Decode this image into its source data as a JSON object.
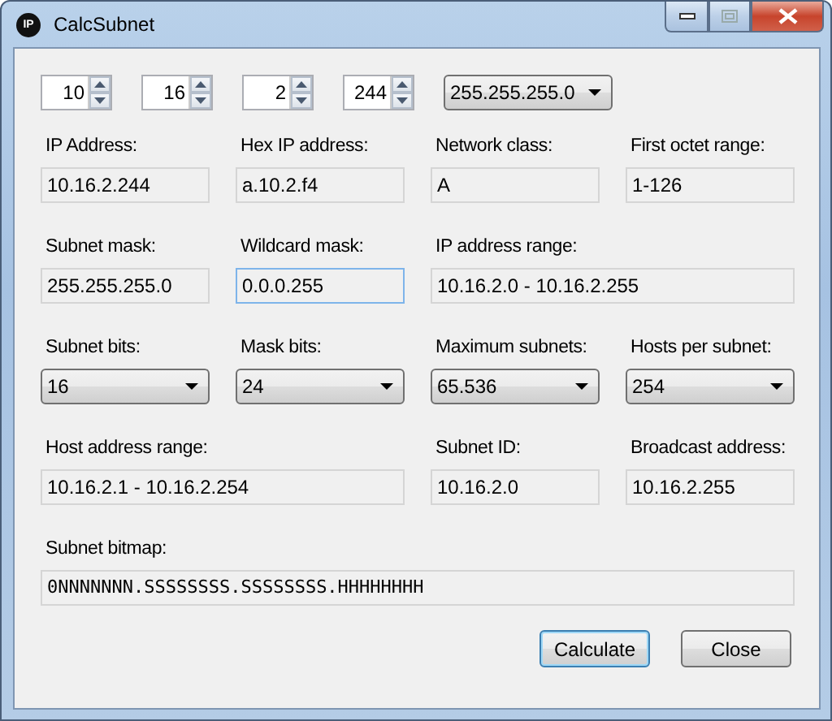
{
  "window": {
    "title": "CalcSubnet",
    "icon_text": "IP"
  },
  "octets": [
    {
      "value": "10"
    },
    {
      "value": "16"
    },
    {
      "value": "2"
    },
    {
      "value": "244"
    }
  ],
  "mask_select": {
    "value": "255.255.255.0"
  },
  "rows": [
    [
      {
        "kind": "text",
        "label": "IP Address:",
        "value": "10.16.2.244",
        "focused": false
      },
      {
        "kind": "text",
        "label": "Hex IP address:",
        "value": "a.10.2.f4",
        "focused": false
      },
      {
        "kind": "text",
        "label": "Network class:",
        "value": "A",
        "focused": false
      },
      {
        "kind": "text",
        "label": "First octet range:",
        "value": "1-126",
        "focused": false
      }
    ],
    [
      {
        "kind": "text",
        "label": "Subnet mask:",
        "value": "255.255.255.0",
        "focused": false
      },
      {
        "kind": "text",
        "label": "Wildcard mask:",
        "value": "0.0.0.255",
        "focused": true
      },
      {
        "kind": "wide",
        "label": "IP address range:",
        "value": "10.16.2.0 - 10.16.2.255",
        "focused": false
      }
    ],
    [
      {
        "kind": "combo",
        "label": "Subnet bits:",
        "value": "16"
      },
      {
        "kind": "combo",
        "label": "Mask bits:",
        "value": "24"
      },
      {
        "kind": "combo",
        "label": "Maximum subnets:",
        "value": "65.536"
      },
      {
        "kind": "combo",
        "label": "Hosts per subnet:",
        "value": "254"
      }
    ],
    [
      {
        "kind": "wide",
        "label": "Host address range:",
        "value": "10.16.2.1 - 10.16.2.254",
        "focused": false
      },
      {
        "kind": "text",
        "label": "Subnet ID:",
        "value": "10.16.2.0",
        "focused": false
      },
      {
        "kind": "text",
        "label": "Broadcast address:",
        "value": "10.16.2.255",
        "focused": false
      }
    ],
    [
      {
        "kind": "bitmap",
        "label": "Subnet bitmap:",
        "value": "0NNNNNNN.SSSSSSSS.SSSSSSSS.HHHHHHHH",
        "focused": false
      }
    ]
  ],
  "buttons": [
    {
      "label": "Calculate",
      "default": true
    },
    {
      "label": "Close",
      "default": false
    }
  ]
}
